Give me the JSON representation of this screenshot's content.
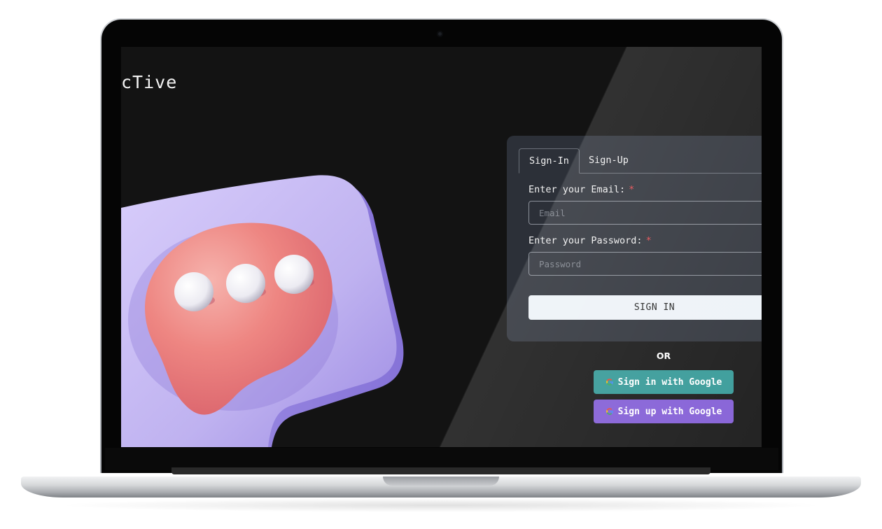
{
  "app": {
    "brand": "cTive"
  },
  "auth": {
    "tabs": [
      {
        "label": "Sign-In",
        "active": true
      },
      {
        "label": "Sign-Up",
        "active": false
      }
    ],
    "email_label": "Enter your Email:",
    "email_required_mark": "*",
    "email_placeholder": "Email",
    "password_label": "Enter your Password:",
    "password_required_mark": "*",
    "password_placeholder": "Password",
    "submit_label": "SIGN IN"
  },
  "alt_auth": {
    "or_text": "OR",
    "google_signin_label": "Sign in with Google",
    "google_signup_label": "Sign up with Google",
    "google_icon": "google-g-icon"
  },
  "colors": {
    "background": "#131313",
    "panel": "#2c3038",
    "signin_button": "#edf2f7",
    "google_signin": "#319795",
    "google_signup": "#805ad5",
    "required": "#e5484d",
    "illustration_bubble_back": "#c3b7f0",
    "illustration_bubble_front": "#ec7c7c"
  }
}
